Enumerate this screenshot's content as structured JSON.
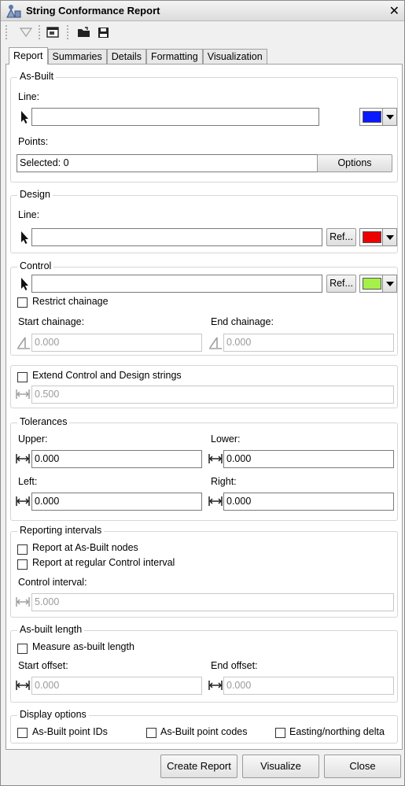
{
  "window": {
    "title": "String Conformance Report"
  },
  "tabs": [
    "Report",
    "Summaries",
    "Details",
    "Formatting",
    "Visualization"
  ],
  "as_built": {
    "legend": "As-Built",
    "line_label": "Line:",
    "line_value": "",
    "line_color": "#0a1aff",
    "points_label": "Points:",
    "selected_text": "Selected: 0",
    "options_label": "Options"
  },
  "design": {
    "legend": "Design",
    "line_label": "Line:",
    "line_value": "",
    "ref_label": "Ref...",
    "color": "#ee0000"
  },
  "control": {
    "legend": "Control",
    "line_value": "",
    "ref_label": "Ref...",
    "color": "#a6f04a",
    "restrict_label": "Restrict chainage",
    "start_label": "Start chainage:",
    "start_value": "0.000",
    "end_label": "End chainage:",
    "end_value": "0.000"
  },
  "extend": {
    "label": "Extend Control and Design strings",
    "value": "0.500"
  },
  "tolerances": {
    "legend": "Tolerances",
    "upper_label": "Upper:",
    "upper_value": "0.000",
    "lower_label": "Lower:",
    "lower_value": "0.000",
    "left_label": "Left:",
    "left_value": "0.000",
    "right_label": "Right:",
    "right_value": "0.000"
  },
  "intervals": {
    "legend": "Reporting intervals",
    "nodes_label": "Report at As-Built nodes",
    "regular_label": "Report at regular Control interval",
    "interval_label": "Control interval:",
    "interval_value": "5.000"
  },
  "asbuilt_length": {
    "legend": "As-built length",
    "measure_label": "Measure as-built length",
    "start_label": "Start offset:",
    "start_value": "0.000",
    "end_label": "End offset:",
    "end_value": "0.000"
  },
  "display": {
    "legend": "Display options",
    "ids_label": "As-Built point IDs",
    "codes_label": "As-Built point codes",
    "delta_label": "Easting/northing delta"
  },
  "footer": {
    "create_label": "Create Report",
    "visualize_label": "Visualize",
    "close_label": "Close"
  }
}
